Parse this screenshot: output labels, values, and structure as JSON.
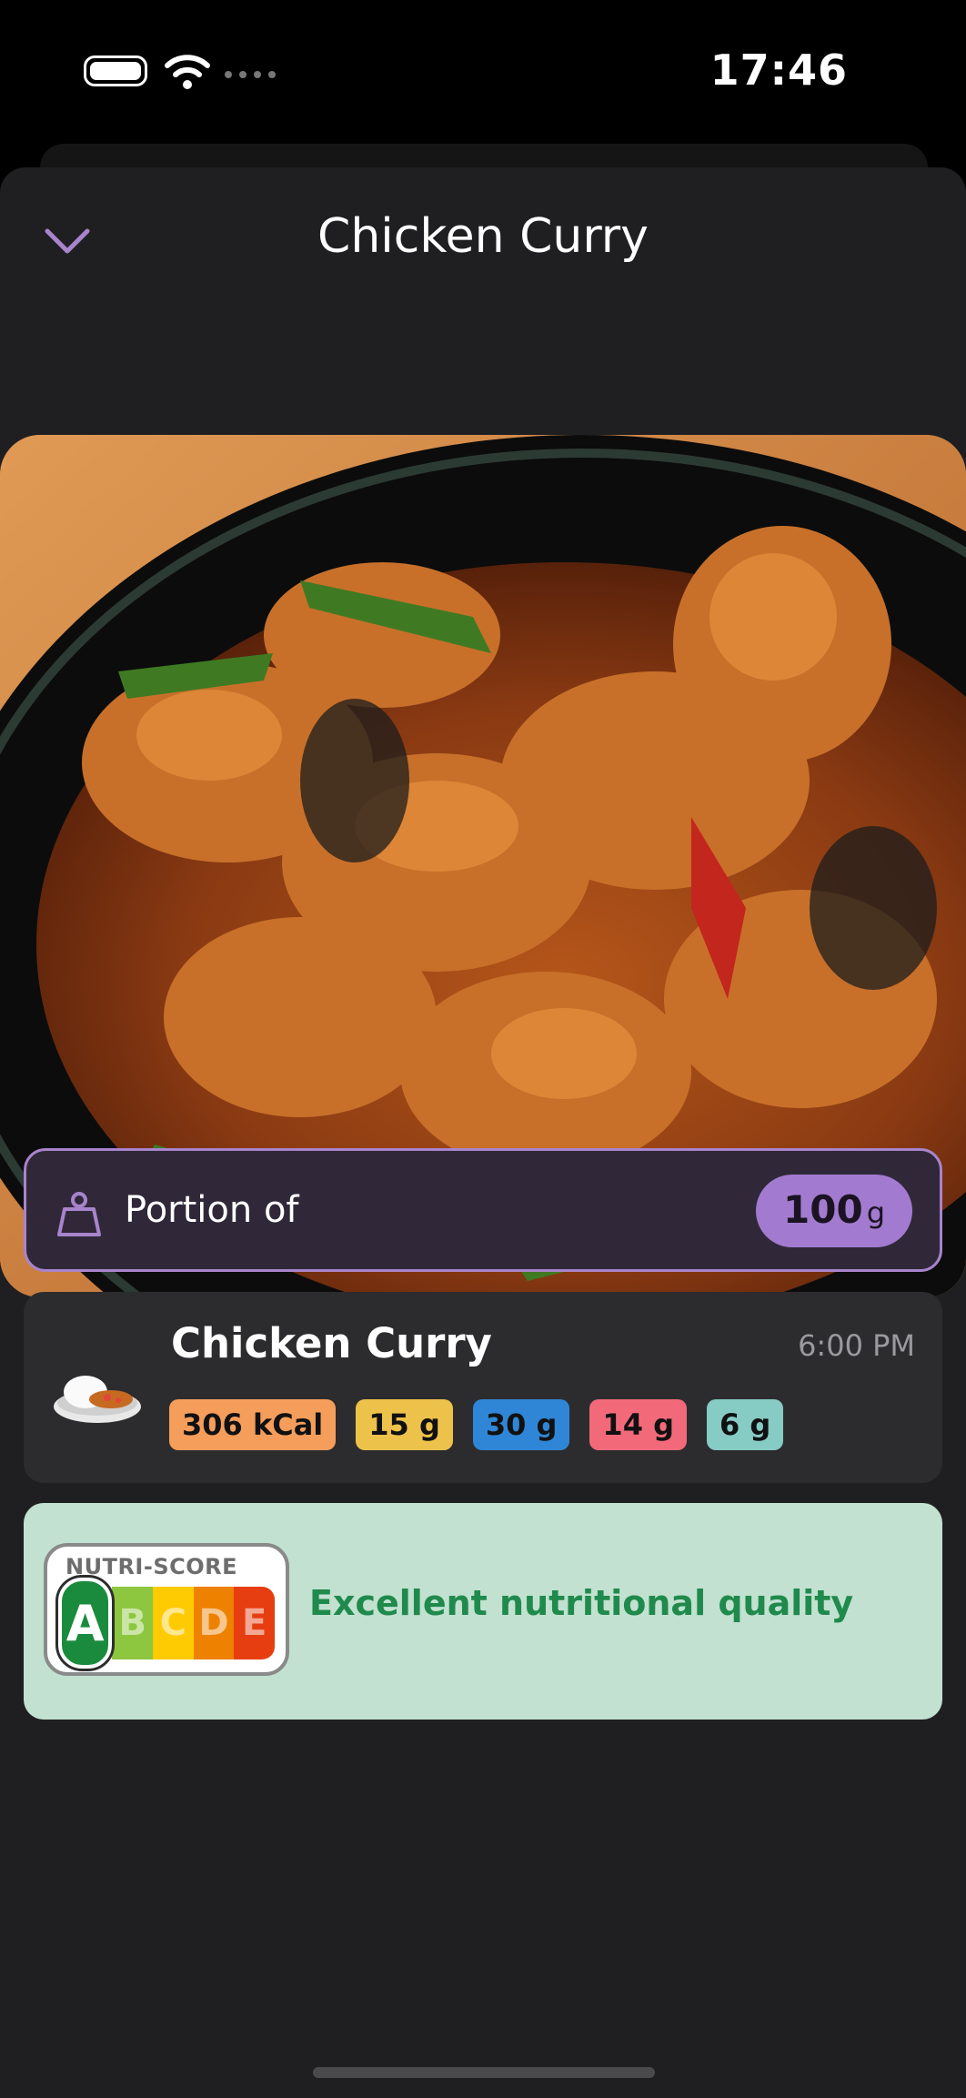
{
  "status_bar": {
    "time": "17:46"
  },
  "header": {
    "title": "Chicken Curry",
    "close_icon": "chevron-down-icon"
  },
  "photo": {
    "subject": "chicken-curry-photo"
  },
  "portion": {
    "label": "Portion of",
    "amount": "100",
    "unit": "g",
    "icon": "scale-icon"
  },
  "meal": {
    "name": "Chicken Curry",
    "time": "6:00 PM",
    "icon": "curry-rice-icon",
    "nutrients": [
      {
        "value": "306 kCal",
        "color": "#f59e5b"
      },
      {
        "value": "15 g",
        "color": "#edc24a"
      },
      {
        "value": "30 g",
        "color": "#2f86d6"
      },
      {
        "value": "14 g",
        "color": "#f26a7a"
      },
      {
        "value": "6 g",
        "color": "#86cbc4"
      }
    ]
  },
  "nutri_score": {
    "header": "NUTRI-SCORE",
    "grade": "A",
    "letters": [
      "A",
      "B",
      "C",
      "D",
      "E"
    ],
    "colors": [
      "#1a8b3d",
      "#8dc63f",
      "#fecb02",
      "#ee8100",
      "#e63e11"
    ],
    "description": "Excellent nutritional quality"
  }
}
